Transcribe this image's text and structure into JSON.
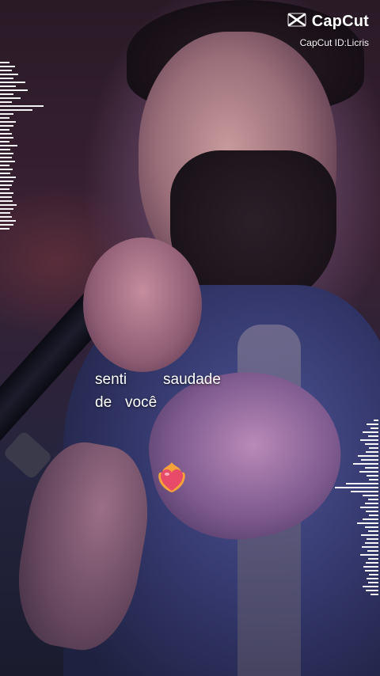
{
  "watermark": {
    "brand": "CapCut",
    "id_text": "CapCut ID:Licris",
    "logo_icon": "capcut-logo-icon"
  },
  "lyrics": {
    "line1": [
      "senti",
      "saudade"
    ],
    "line2": [
      "de",
      "você"
    ]
  },
  "sticker": {
    "icon": "heart-on-fire-icon",
    "color": "#e84a6a"
  },
  "visualizer": {
    "left_levels": [
      0.2,
      0.33,
      0.25,
      0.4,
      0.3,
      0.55,
      0.35,
      0.6,
      0.3,
      0.45,
      0.25,
      0.95,
      0.7,
      0.3,
      0.2,
      0.35,
      0.3,
      0.2,
      0.25,
      0.3,
      0.2,
      0.38,
      0.22,
      0.3,
      0.26,
      0.33,
      0.2,
      0.28,
      0.22,
      0.35,
      0.3,
      0.25,
      0.2,
      0.3,
      0.25,
      0.28,
      0.36,
      0.3,
      0.22,
      0.26,
      0.34,
      0.3,
      0.2
    ],
    "right_levels": [
      0.1,
      0.25,
      0.18,
      0.35,
      0.22,
      0.4,
      0.3,
      0.2,
      0.28,
      0.45,
      0.38,
      0.55,
      0.3,
      0.42,
      0.25,
      0.2,
      0.7,
      0.95,
      0.6,
      0.35,
      0.22,
      0.3,
      0.4,
      0.28,
      0.2,
      0.34,
      0.46,
      0.3,
      0.22,
      0.38,
      0.26,
      0.3,
      0.36,
      0.24,
      0.4,
      0.22,
      0.28,
      0.32,
      0.3,
      0.2,
      0.26,
      0.22,
      0.34,
      0.28,
      0.18
    ]
  }
}
